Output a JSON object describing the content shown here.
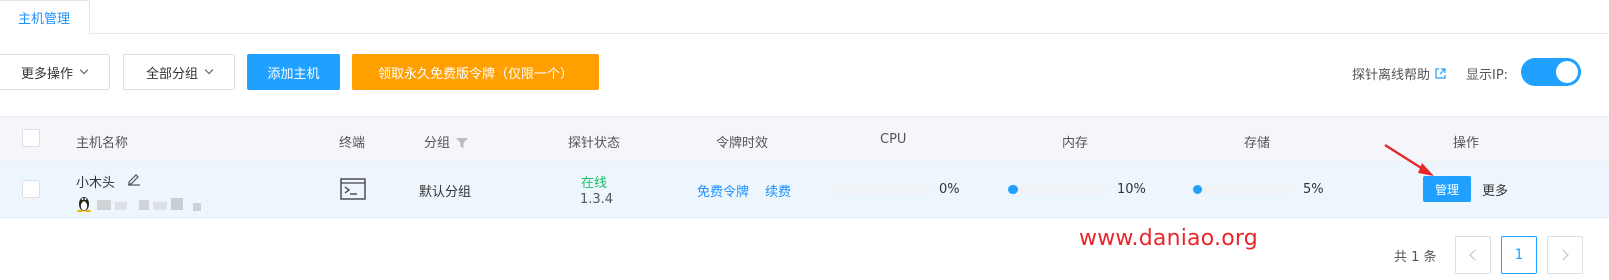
{
  "tabs": [
    {
      "label": "主机管理",
      "active": true
    }
  ],
  "toolbar": {
    "more_ops_label": "更多操作",
    "all_groups_label": "全部分组",
    "add_host_label": "添加主机",
    "free_token_label": "领取永久免费版令牌（仅限一个）",
    "help_label": "探针离线帮助",
    "show_ip_label": "显示IP:",
    "show_ip_enabled": true
  },
  "table": {
    "columns": {
      "name": "主机名称",
      "terminal": "终端",
      "group": "分组",
      "probe_status": "探针状态",
      "token_validity": "令牌时效",
      "cpu": "CPU",
      "memory": "内存",
      "storage": "存储",
      "actions": "操作"
    },
    "rows": [
      {
        "name": "小木头",
        "group": "默认分组",
        "status": "在线",
        "version": "1.3.4",
        "token_type": "免费令牌",
        "renew_label": "续费",
        "cpu": "0%",
        "cpu_value": 0,
        "memory": "10%",
        "memory_value": 0.1,
        "storage": "5%",
        "storage_value": 0.05,
        "manage_label": "管理",
        "more_label": "更多"
      }
    ]
  },
  "pagination": {
    "total_label": "共 1 条",
    "current_page": "1"
  },
  "watermark": "www.daniao.org",
  "colors": {
    "primary": "#20a0ff",
    "orange": "#ff9f00",
    "online": "#19be6b",
    "annotation": "#e8262b"
  }
}
